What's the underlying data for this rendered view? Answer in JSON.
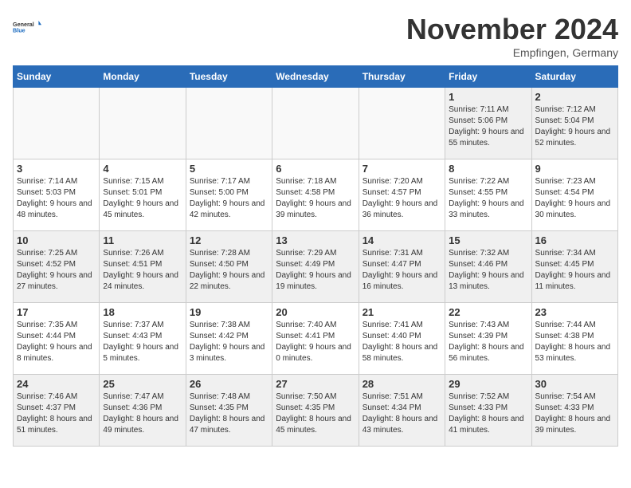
{
  "logo": {
    "general": "General",
    "blue": "Blue"
  },
  "title": "November 2024",
  "location": "Empfingen, Germany",
  "days_of_week": [
    "Sunday",
    "Monday",
    "Tuesday",
    "Wednesday",
    "Thursday",
    "Friday",
    "Saturday"
  ],
  "weeks": [
    [
      {
        "day": "",
        "info": "",
        "empty": true
      },
      {
        "day": "",
        "info": "",
        "empty": true
      },
      {
        "day": "",
        "info": "",
        "empty": true
      },
      {
        "day": "",
        "info": "",
        "empty": true
      },
      {
        "day": "",
        "info": "",
        "empty": true
      },
      {
        "day": "1",
        "info": "Sunrise: 7:11 AM\nSunset: 5:06 PM\nDaylight: 9 hours and 55 minutes."
      },
      {
        "day": "2",
        "info": "Sunrise: 7:12 AM\nSunset: 5:04 PM\nDaylight: 9 hours and 52 minutes."
      }
    ],
    [
      {
        "day": "3",
        "info": "Sunrise: 7:14 AM\nSunset: 5:03 PM\nDaylight: 9 hours and 48 minutes."
      },
      {
        "day": "4",
        "info": "Sunrise: 7:15 AM\nSunset: 5:01 PM\nDaylight: 9 hours and 45 minutes."
      },
      {
        "day": "5",
        "info": "Sunrise: 7:17 AM\nSunset: 5:00 PM\nDaylight: 9 hours and 42 minutes."
      },
      {
        "day": "6",
        "info": "Sunrise: 7:18 AM\nSunset: 4:58 PM\nDaylight: 9 hours and 39 minutes."
      },
      {
        "day": "7",
        "info": "Sunrise: 7:20 AM\nSunset: 4:57 PM\nDaylight: 9 hours and 36 minutes."
      },
      {
        "day": "8",
        "info": "Sunrise: 7:22 AM\nSunset: 4:55 PM\nDaylight: 9 hours and 33 minutes."
      },
      {
        "day": "9",
        "info": "Sunrise: 7:23 AM\nSunset: 4:54 PM\nDaylight: 9 hours and 30 minutes."
      }
    ],
    [
      {
        "day": "10",
        "info": "Sunrise: 7:25 AM\nSunset: 4:52 PM\nDaylight: 9 hours and 27 minutes."
      },
      {
        "day": "11",
        "info": "Sunrise: 7:26 AM\nSunset: 4:51 PM\nDaylight: 9 hours and 24 minutes."
      },
      {
        "day": "12",
        "info": "Sunrise: 7:28 AM\nSunset: 4:50 PM\nDaylight: 9 hours and 22 minutes."
      },
      {
        "day": "13",
        "info": "Sunrise: 7:29 AM\nSunset: 4:49 PM\nDaylight: 9 hours and 19 minutes."
      },
      {
        "day": "14",
        "info": "Sunrise: 7:31 AM\nSunset: 4:47 PM\nDaylight: 9 hours and 16 minutes."
      },
      {
        "day": "15",
        "info": "Sunrise: 7:32 AM\nSunset: 4:46 PM\nDaylight: 9 hours and 13 minutes."
      },
      {
        "day": "16",
        "info": "Sunrise: 7:34 AM\nSunset: 4:45 PM\nDaylight: 9 hours and 11 minutes."
      }
    ],
    [
      {
        "day": "17",
        "info": "Sunrise: 7:35 AM\nSunset: 4:44 PM\nDaylight: 9 hours and 8 minutes."
      },
      {
        "day": "18",
        "info": "Sunrise: 7:37 AM\nSunset: 4:43 PM\nDaylight: 9 hours and 5 minutes."
      },
      {
        "day": "19",
        "info": "Sunrise: 7:38 AM\nSunset: 4:42 PM\nDaylight: 9 hours and 3 minutes."
      },
      {
        "day": "20",
        "info": "Sunrise: 7:40 AM\nSunset: 4:41 PM\nDaylight: 9 hours and 0 minutes."
      },
      {
        "day": "21",
        "info": "Sunrise: 7:41 AM\nSunset: 4:40 PM\nDaylight: 8 hours and 58 minutes."
      },
      {
        "day": "22",
        "info": "Sunrise: 7:43 AM\nSunset: 4:39 PM\nDaylight: 8 hours and 56 minutes."
      },
      {
        "day": "23",
        "info": "Sunrise: 7:44 AM\nSunset: 4:38 PM\nDaylight: 8 hours and 53 minutes."
      }
    ],
    [
      {
        "day": "24",
        "info": "Sunrise: 7:46 AM\nSunset: 4:37 PM\nDaylight: 8 hours and 51 minutes."
      },
      {
        "day": "25",
        "info": "Sunrise: 7:47 AM\nSunset: 4:36 PM\nDaylight: 8 hours and 49 minutes."
      },
      {
        "day": "26",
        "info": "Sunrise: 7:48 AM\nSunset: 4:35 PM\nDaylight: 8 hours and 47 minutes."
      },
      {
        "day": "27",
        "info": "Sunrise: 7:50 AM\nSunset: 4:35 PM\nDaylight: 8 hours and 45 minutes."
      },
      {
        "day": "28",
        "info": "Sunrise: 7:51 AM\nSunset: 4:34 PM\nDaylight: 8 hours and 43 minutes."
      },
      {
        "day": "29",
        "info": "Sunrise: 7:52 AM\nSunset: 4:33 PM\nDaylight: 8 hours and 41 minutes."
      },
      {
        "day": "30",
        "info": "Sunrise: 7:54 AM\nSunset: 4:33 PM\nDaylight: 8 hours and 39 minutes."
      }
    ]
  ]
}
